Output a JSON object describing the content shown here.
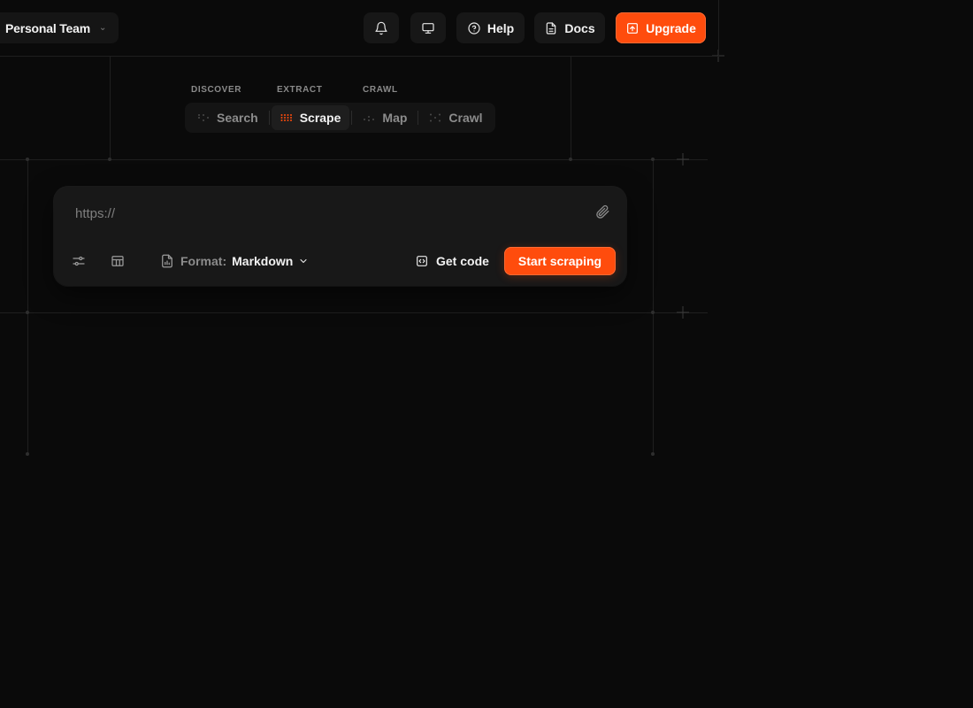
{
  "team": {
    "name": "Personal Team"
  },
  "topbar": {
    "help_label": "Help",
    "docs_label": "Docs",
    "upgrade_label": "Upgrade"
  },
  "tabs": {
    "groups": [
      "DISCOVER",
      "EXTRACT",
      "CRAWL"
    ],
    "items": [
      {
        "label": "Search",
        "active": false
      },
      {
        "label": "Scrape",
        "active": true
      },
      {
        "label": "Map",
        "active": false
      },
      {
        "label": "Crawl",
        "active": false
      }
    ]
  },
  "scrape": {
    "url_placeholder": "https://",
    "url_value": "",
    "format_label": "Format:",
    "format_value": "Markdown",
    "get_code_label": "Get code",
    "start_label": "Start scraping"
  },
  "colors": {
    "background": "#0a0a0a",
    "accent": "#ff4c0d",
    "surface": "#181818"
  },
  "icons": {
    "bell": "bell-icon",
    "monitor": "monitor-icon",
    "help": "help-circle-icon",
    "docs": "document-icon",
    "upgrade": "upload-square-icon",
    "attach": "paperclip-icon",
    "settings": "sliders-icon",
    "table": "table-icon",
    "format": "file-chart-icon",
    "code": "code-square-icon"
  }
}
